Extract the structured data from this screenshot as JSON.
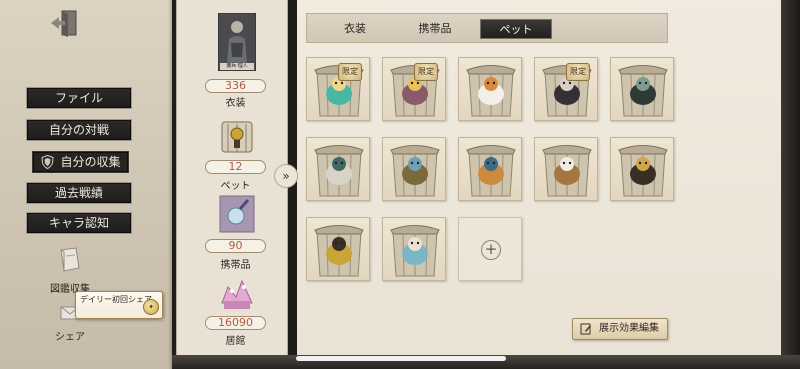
{
  "nav": {
    "items": [
      {
        "label": "ファイル"
      },
      {
        "label": "自分の対戦"
      },
      {
        "label": "自分の収集"
      },
      {
        "label": "過去戦績"
      },
      {
        "label": "キャラ認知"
      }
    ],
    "active_index": 2
  },
  "side": {
    "encyclopedia_label": "図鑑収集",
    "share_label": "シェア",
    "daily_share_label": "デイリー初回シェア"
  },
  "summary": {
    "portrait_caption": "傭兵·理人",
    "costume": {
      "count": "336",
      "label": "衣装"
    },
    "pet": {
      "count": "12",
      "label": "ペット"
    },
    "carry": {
      "count": "90",
      "label": "携帯品"
    },
    "residence": {
      "count": "16090",
      "label": "居館"
    }
  },
  "tabs": [
    {
      "label": "衣装"
    },
    {
      "label": "携帯品"
    },
    {
      "label": "ペット"
    }
  ],
  "active_tab": "ペット",
  "pets": {
    "limited_label": "限定",
    "items": [
      {
        "name": "teal-bird-pet",
        "limited": true
      },
      {
        "name": "jester-puppet-pet",
        "limited": true
      },
      {
        "name": "white-fox-pet",
        "limited": false
      },
      {
        "name": "dark-doll-pet",
        "limited": true
      },
      {
        "name": "shadow-creature-pet",
        "limited": false
      },
      {
        "name": "chibi-doll-pet",
        "limited": false
      },
      {
        "name": "winged-bird-pet",
        "limited": false
      },
      {
        "name": "shiba-dog-pet",
        "limited": false
      },
      {
        "name": "calico-cat-pet",
        "limited": false
      },
      {
        "name": "music-box-pet",
        "limited": false
      },
      {
        "name": "gramophone-pet",
        "limited": false
      },
      {
        "name": "blue-flower-pet",
        "limited": false
      }
    ],
    "add_slot": true
  },
  "edit_button_label": "展示効果編集",
  "colors": {
    "accent_count": "#b25b43",
    "dark_button": "#242220",
    "panel_bg": "#e9e2d4"
  }
}
